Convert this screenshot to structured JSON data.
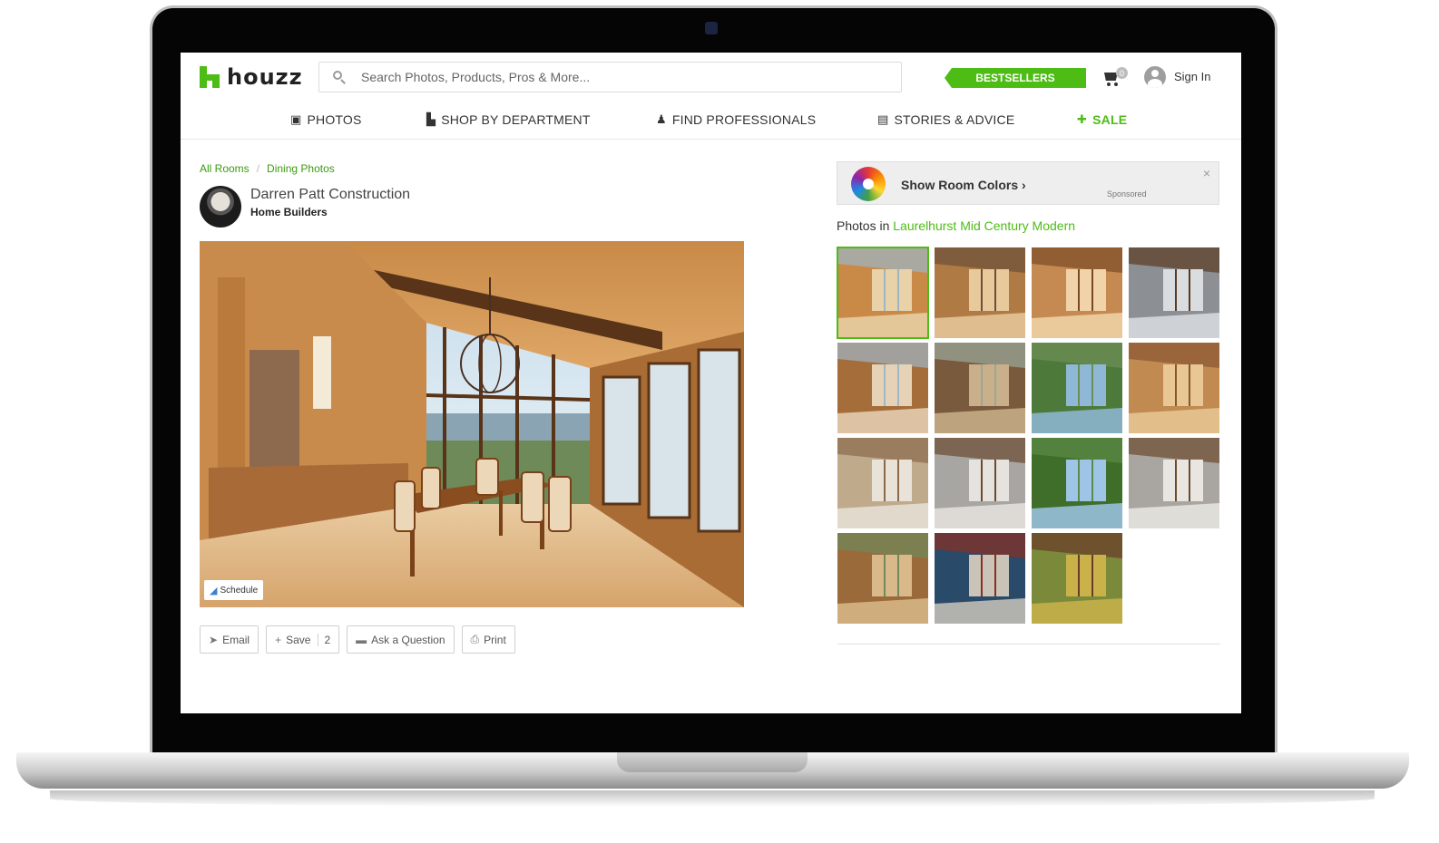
{
  "header": {
    "logo_text": "houzz",
    "search_placeholder": "Search Photos, Products, Pros & More...",
    "bestsellers_label": "BESTSELLERS",
    "cart_count": "0",
    "signin_label": "Sign In"
  },
  "nav": {
    "items": [
      {
        "label": "PHOTOS",
        "icon": "photos-icon"
      },
      {
        "label": "SHOP BY DEPARTMENT",
        "icon": "armchair-icon"
      },
      {
        "label": "FIND PROFESSIONALS",
        "icon": "person-icon"
      },
      {
        "label": "STORIES & ADVICE",
        "icon": "book-icon"
      },
      {
        "label": "SALE",
        "icon": "gift-icon"
      }
    ]
  },
  "breadcrumb": {
    "items": [
      "All Rooms",
      "Dining Photos"
    ],
    "separator": "/"
  },
  "pro": {
    "name": "Darren Patt Construction",
    "type": "Home Builders"
  },
  "photo": {
    "schedule_label": "Schedule"
  },
  "actions": {
    "email": "Email",
    "save": "Save",
    "save_count": "2",
    "ask": "Ask a Question",
    "print": "Print"
  },
  "ad": {
    "text": "Show Room Colors ›",
    "sponsored": "Sponsored",
    "close": "×"
  },
  "project": {
    "prefix": "Photos in",
    "name": "Laurelhurst Mid Century Modern",
    "thumbnail_count": 15,
    "selected_index": 0
  },
  "colors": {
    "brand_green": "#4dbc15",
    "text": "#333333"
  }
}
